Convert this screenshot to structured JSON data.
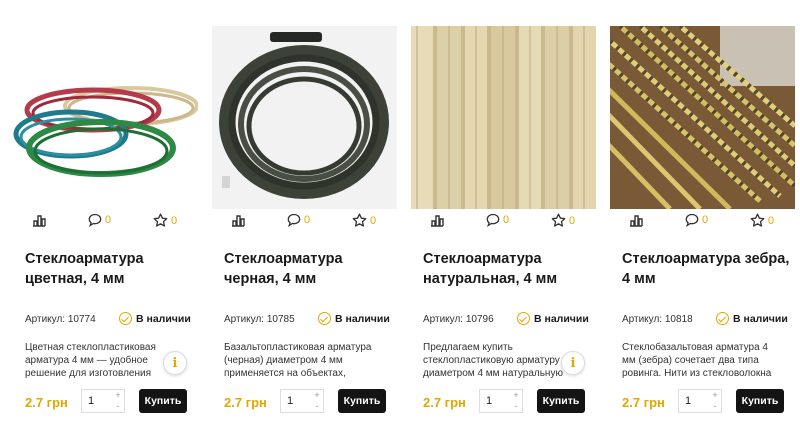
{
  "labels": {
    "sku_prefix": "Артикул:",
    "in_stock": "В наличии",
    "buy": "Купить",
    "info_symbol": "i"
  },
  "accent_color": "#e0a800",
  "products": [
    {
      "title": "Стеклоарматура цветная, 4 мм",
      "sku": "Артикул: 10774",
      "stock": "В наличии",
      "description": "Цветная стеклопластиковая арматура 4 мм — удобное решение для изготовления",
      "price": "2.7 грн",
      "qty": "1",
      "comments": "0",
      "favorites": "0",
      "buy": "Купить",
      "image": "colored-rebar-coils"
    },
    {
      "title": "Стеклоарматура черная, 4 мм",
      "sku": "Артикул: 10785",
      "stock": "В наличии",
      "description": "Базальтопластиковая арматура (черная) диаметром 4 мм применяется на объектах,",
      "price": "2.7 грн",
      "qty": "1",
      "comments": "0",
      "favorites": "0",
      "buy": "Купить",
      "image": "black-rebar-coil"
    },
    {
      "title": "Стеклоарматура натуральная, 4 мм",
      "sku": "Артикул: 10796",
      "stock": "В наличии",
      "description": "Предлагаем купить стеклопластиковую арматуру диаметром 4 мм натуральную",
      "price": "2.7 грн",
      "qty": "1",
      "comments": "0",
      "favorites": "0",
      "buy": "Купить",
      "image": "natural-rebar-rods"
    },
    {
      "title": "Стеклоарматура зебра, 4 мм",
      "sku": "Артикул: 10818",
      "stock": "В наличии",
      "description": "Стеклобазальтовая арматура 4 мм (зебра) сочетает два типа ровинга. Нити из стекловолокна",
      "price": "2.7 грн",
      "qty": "1",
      "comments": "0",
      "favorites": "0",
      "buy": "Купить",
      "image": "zebra-rebar-rods"
    }
  ]
}
